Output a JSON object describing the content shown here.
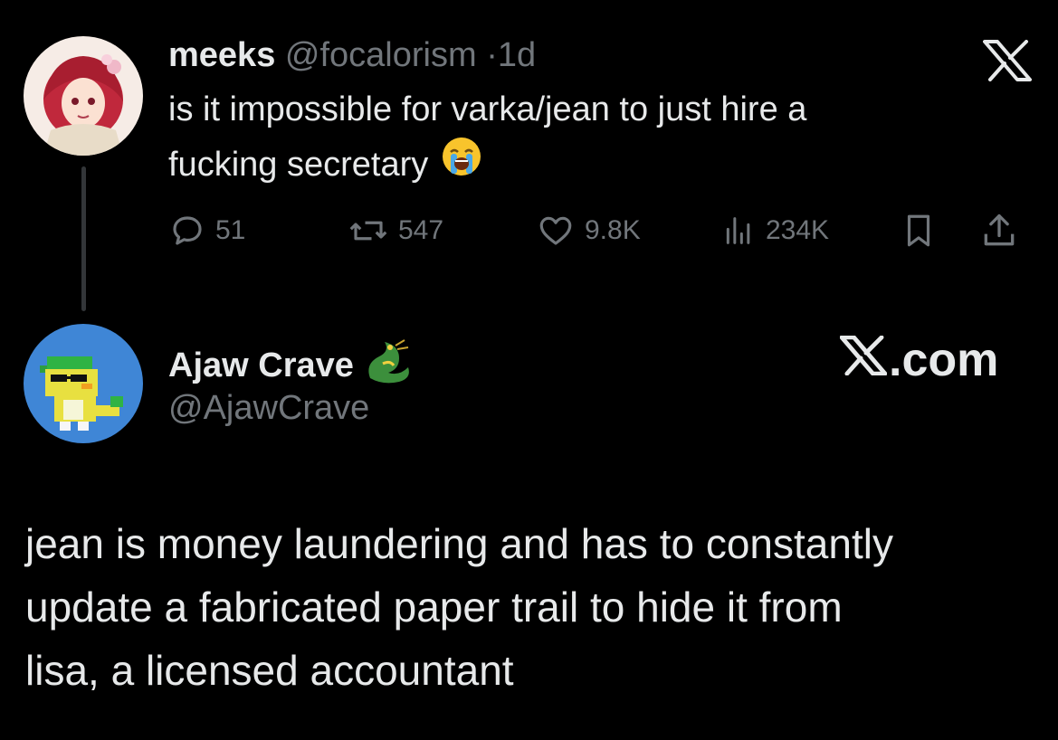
{
  "tweet": {
    "display_name": "meeks",
    "handle": "@focalorism",
    "separator": "·",
    "age": "1d",
    "text_line1": "is it impossible for varka/jean to just hire a",
    "text_line2": "fucking secretary",
    "emoji": "loudly-crying-face-emoji",
    "stats": {
      "replies": "51",
      "reposts": "547",
      "likes": "9.8K",
      "views": "234K"
    }
  },
  "reply_user": {
    "display_name": "Ajaw Crave",
    "badge_icon": "dragon-emoji",
    "handle": "@AjawCrave"
  },
  "branding": {
    "logo_top": "x-logo-icon",
    "logo_site": ".com"
  },
  "reply": {
    "line1": "jean is money laundering and has to constantly",
    "line2": "update a fabricated paper trail to hide it from",
    "line3": "lisa, a licensed accountant"
  },
  "colors": {
    "background": "#000000",
    "text": "#e7e9ea",
    "muted": "#71767b"
  }
}
